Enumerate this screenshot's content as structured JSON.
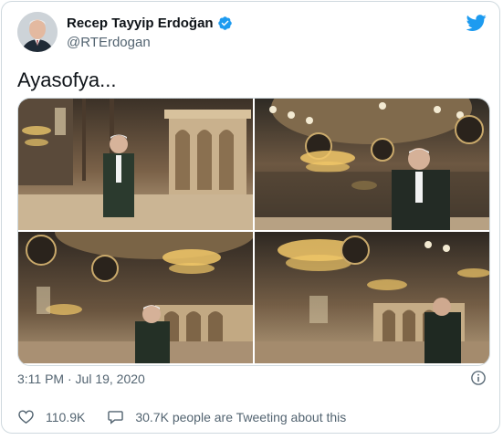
{
  "colors": {
    "brand": "#1d9bf0",
    "text_primary": "#0f1419",
    "text_secondary": "#536471",
    "border": "#cfd9de"
  },
  "author": {
    "display_name": "Recep Tayyip Erdoğan",
    "handle": "@RTErdogan",
    "verified_icon": "verified-badge-icon",
    "avatar_icon": "avatar"
  },
  "header": {
    "logo_icon": "twitter-bird-icon"
  },
  "tweet": {
    "text": "Ayasofya...",
    "media": [
      {
        "name": "hagia-sophia-photo-1"
      },
      {
        "name": "hagia-sophia-photo-2"
      },
      {
        "name": "hagia-sophia-photo-3"
      },
      {
        "name": "hagia-sophia-photo-4"
      }
    ],
    "timestamp": "3:11 PM · Jul 19, 2020",
    "info_icon": "info-icon"
  },
  "actions": {
    "like": {
      "icon": "heart-icon",
      "label": "110.9K"
    },
    "reply": {
      "icon": "speech-bubble-icon",
      "label": "30.7K people are Tweeting about this"
    }
  }
}
